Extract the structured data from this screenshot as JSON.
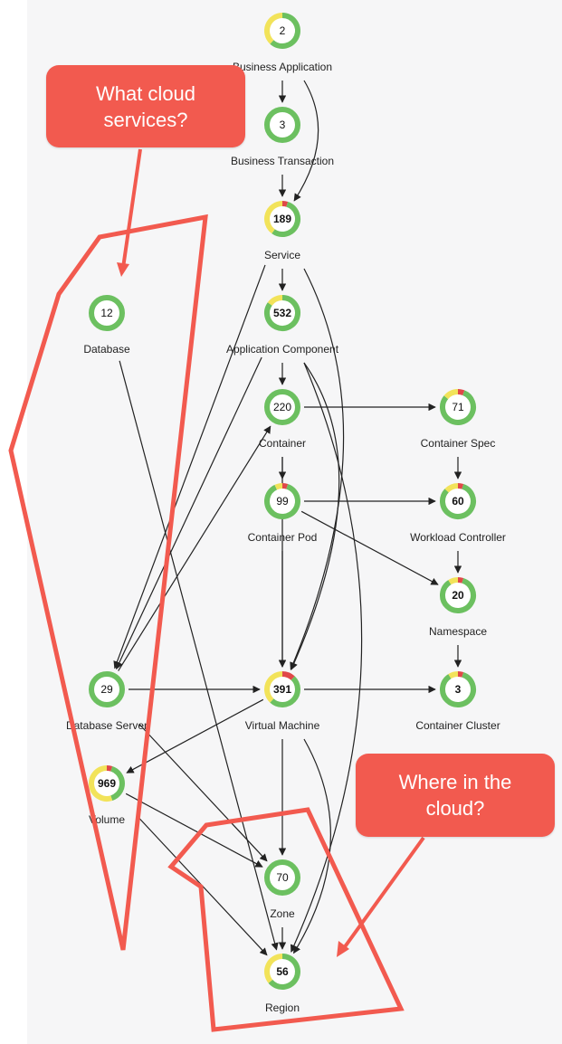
{
  "colors": {
    "ok": "#6cc060",
    "warning": "#f2e35a",
    "critical": "#e04848",
    "edge": "#222222",
    "annotation": "#f25a4f"
  },
  "nodes": [
    {
      "id": "business-application",
      "label": "Business Application",
      "count": "2",
      "bold": false,
      "health": {
        "ok": 0.62,
        "warning": 0.38,
        "critical": 0
      }
    },
    {
      "id": "business-transaction",
      "label": "Business Transaction",
      "count": "3",
      "bold": false,
      "health": {
        "ok": 1,
        "warning": 0,
        "critical": 0
      }
    },
    {
      "id": "service",
      "label": "Service",
      "count": "189",
      "bold": true,
      "health": {
        "ok": 0.55,
        "warning": 0.4,
        "critical": 0.05
      }
    },
    {
      "id": "database",
      "label": "Database",
      "count": "12",
      "bold": false,
      "health": {
        "ok": 1,
        "warning": 0,
        "critical": 0
      }
    },
    {
      "id": "application-component",
      "label": "Application Component",
      "count": "532",
      "bold": true,
      "health": {
        "ok": 0.85,
        "warning": 0.15,
        "critical": 0
      }
    },
    {
      "id": "container",
      "label": "Container",
      "count": "220",
      "bold": false,
      "health": {
        "ok": 1,
        "warning": 0,
        "critical": 0
      }
    },
    {
      "id": "container-spec",
      "label": "Container Spec",
      "count": "71",
      "bold": false,
      "health": {
        "ok": 0.8,
        "warning": 0.14,
        "critical": 0.06
      }
    },
    {
      "id": "container-pod",
      "label": "Container Pod",
      "count": "99",
      "bold": false,
      "health": {
        "ok": 0.88,
        "warning": 0.07,
        "critical": 0.05
      }
    },
    {
      "id": "workload-controller",
      "label": "Workload Controller",
      "count": "60",
      "bold": true,
      "health": {
        "ok": 0.82,
        "warning": 0.13,
        "critical": 0.05
      }
    },
    {
      "id": "namespace",
      "label": "Namespace",
      "count": "20",
      "bold": true,
      "health": {
        "ok": 0.86,
        "warning": 0.09,
        "critical": 0.05
      }
    },
    {
      "id": "database-server",
      "label": "Database Server",
      "count": "29",
      "bold": false,
      "health": {
        "ok": 1,
        "warning": 0,
        "critical": 0
      }
    },
    {
      "id": "virtual-machine",
      "label": "Virtual Machine",
      "count": "391",
      "bold": true,
      "health": {
        "ok": 0.5,
        "warning": 0.38,
        "critical": 0.12
      }
    },
    {
      "id": "container-cluster",
      "label": "Container Cluster",
      "count": "3",
      "bold": true,
      "health": {
        "ok": 0.86,
        "warning": 0.09,
        "critical": 0.05
      }
    },
    {
      "id": "volume",
      "label": "Volume",
      "count": "969",
      "bold": true,
      "health": {
        "ok": 0.4,
        "warning": 0.55,
        "critical": 0.05
      }
    },
    {
      "id": "zone",
      "label": "Zone",
      "count": "70",
      "bold": false,
      "health": {
        "ok": 1,
        "warning": 0,
        "critical": 0
      }
    },
    {
      "id": "region",
      "label": "Region",
      "count": "56",
      "bold": true,
      "health": {
        "ok": 0.64,
        "warning": 0.36,
        "critical": 0
      }
    }
  ],
  "edges": [
    [
      "business-application",
      "business-transaction"
    ],
    [
      "business-application",
      "service"
    ],
    [
      "business-transaction",
      "service"
    ],
    [
      "service",
      "application-component"
    ],
    [
      "service",
      "database-server"
    ],
    [
      "service",
      "virtual-machine"
    ],
    [
      "application-component",
      "container"
    ],
    [
      "application-component",
      "database-server"
    ],
    [
      "application-component",
      "virtual-machine"
    ],
    [
      "application-component",
      "region"
    ],
    [
      "container",
      "container-spec"
    ],
    [
      "container",
      "container-pod"
    ],
    [
      "container",
      "virtual-machine"
    ],
    [
      "container-spec",
      "workload-controller"
    ],
    [
      "container-pod",
      "workload-controller"
    ],
    [
      "container-pod",
      "namespace"
    ],
    [
      "container-pod",
      "virtual-machine"
    ],
    [
      "workload-controller",
      "namespace"
    ],
    [
      "namespace",
      "container-cluster"
    ],
    [
      "database",
      "region"
    ],
    [
      "database-server",
      "container"
    ],
    [
      "database-server",
      "virtual-machine"
    ],
    [
      "database-server",
      "zone"
    ],
    [
      "virtual-machine",
      "container-cluster"
    ],
    [
      "virtual-machine",
      "volume"
    ],
    [
      "virtual-machine",
      "zone"
    ],
    [
      "virtual-machine",
      "region"
    ],
    [
      "volume",
      "zone"
    ],
    [
      "volume",
      "region"
    ],
    [
      "zone",
      "region"
    ]
  ],
  "callouts": {
    "cloud_services": "What cloud\nservices?",
    "where_in_cloud": "Where in the\ncloud?"
  }
}
